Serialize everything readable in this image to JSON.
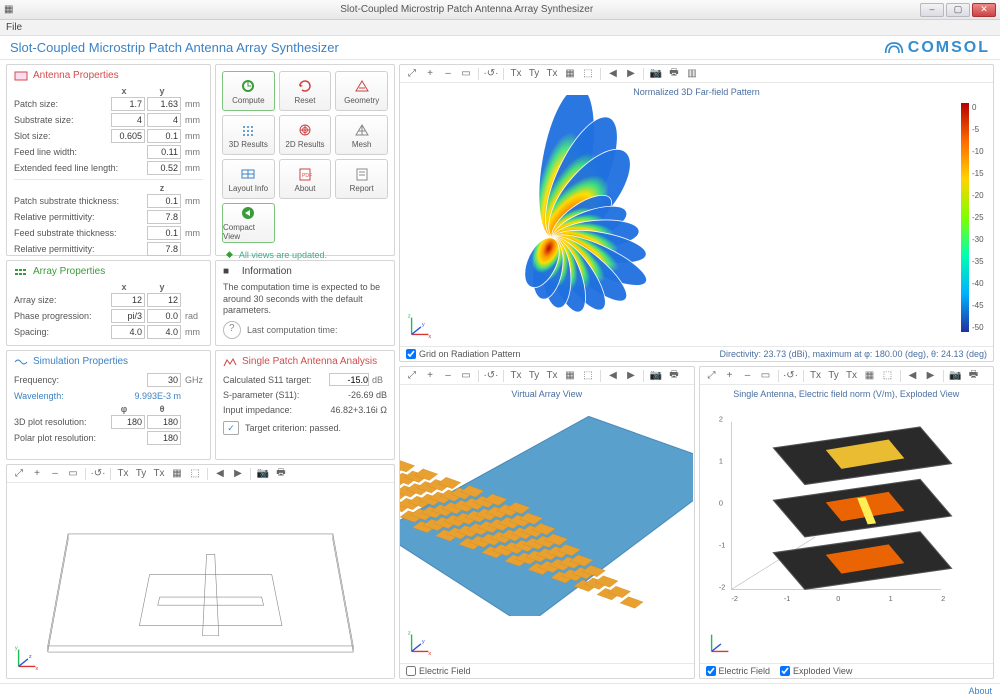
{
  "window": {
    "title": "Slot-Coupled Microstrip Patch Antenna Array Synthesizer",
    "min_icon": "–",
    "max_icon": "▢",
    "close_icon": "✕"
  },
  "menubar": {
    "file": "File"
  },
  "header": {
    "title": "Slot-Coupled Microstrip Patch Antenna Array Synthesizer",
    "brand": "COMSOL"
  },
  "antenna": {
    "title": "Antenna Properties",
    "col_x": "x",
    "col_y": "y",
    "rows_xy": [
      {
        "label": "Patch size:",
        "x": "1.7",
        "y": "1.63",
        "unit": "mm"
      },
      {
        "label": "Substrate size:",
        "x": "4",
        "y": "4",
        "unit": "mm"
      },
      {
        "label": "Slot size:",
        "x": "0.605",
        "y": "0.1",
        "unit": "mm"
      }
    ],
    "rows_single": [
      {
        "label": "Feed line width:",
        "v": "0.11",
        "unit": "mm"
      },
      {
        "label": "Extended feed line length:",
        "v": "0.52",
        "unit": "mm"
      }
    ],
    "col_z": "z",
    "rows_z": [
      {
        "label": "Patch substrate thickness:",
        "v": "0.1",
        "unit": "mm"
      },
      {
        "label": "Relative permittivity:",
        "v": "7.8",
        "unit": ""
      },
      {
        "label": "Feed substrate thickness:",
        "v": "0.1",
        "unit": "mm"
      },
      {
        "label": "Relative permittivity:",
        "v": "7.8",
        "unit": ""
      }
    ]
  },
  "array": {
    "title": "Array Properties",
    "col_x": "x",
    "col_y": "y",
    "rows": [
      {
        "label": "Array size:",
        "x": "12",
        "y": "12",
        "unit": ""
      },
      {
        "label": "Phase progression:",
        "x": "pi/3",
        "y": "0.0",
        "unit": "rad"
      },
      {
        "label": "Spacing:",
        "x": "4.0",
        "y": "4.0",
        "unit": "mm"
      }
    ]
  },
  "sim": {
    "title": "Simulation Properties",
    "freq_label": "Frequency:",
    "freq_v": "30",
    "freq_unit": "GHz",
    "wl_label": "Wavelength:",
    "wl_v": "9.993E-3 m",
    "col_phi": "φ",
    "col_theta": "θ",
    "res3d_label": "3D plot resolution:",
    "res3d_phi": "180",
    "res3d_theta": "180",
    "polar_label": "Polar plot resolution:",
    "polar_v": "180"
  },
  "buttons": {
    "labels": [
      "Compute",
      "Reset",
      "Geometry",
      "3D Results",
      "2D Results",
      "Mesh",
      "Layout Info",
      "About",
      "Report",
      "Compact View"
    ],
    "status_icon": "◆",
    "status": "All views are updated."
  },
  "info": {
    "title": "Information",
    "text": "The computation time is expected to be around 30 seconds with the default parameters.",
    "last_label": "Last computation time:"
  },
  "single": {
    "title": "Single Patch Antenna Analysis",
    "rows": [
      {
        "label": "Calculated S11 target:",
        "val": "-15.0",
        "unit": "dB",
        "input": true
      },
      {
        "label": "S-parameter (S11):",
        "val": "-26.69 dB"
      },
      {
        "label": "Input impedance:",
        "val": "46.82+3.16i Ω"
      }
    ],
    "pass": "Target criterion: passed."
  },
  "view_far": {
    "title": "Normalized 3D Far-field Pattern",
    "grid_label": "Grid on Radiation Pattern",
    "directivity": "Directivity: 23.73 (dBi), maximum at φ: 180.00 (deg), θ: 24.13 (deg)",
    "colorbar": [
      "0",
      "-5",
      "-10",
      "-15",
      "-20",
      "-25",
      "-30",
      "-35",
      "-40",
      "-45",
      "-50"
    ]
  },
  "view_array": {
    "title": "Virtual Array View",
    "ef_label": "Electric Field"
  },
  "view_single": {
    "title": "Single Antenna, Electric field norm (V/m), Exploded View",
    "ef_label": "Electric Field",
    "exp_label": "Exploded View",
    "axis_ticks": [
      "-2",
      "-1",
      "0",
      "1",
      "2"
    ]
  },
  "toolbar": {
    "zoom_fit": "⤢",
    "zoom_in": "+",
    "zoom_out": "–",
    "zoom_box": "▭",
    "rotate": "·↺·",
    "xy": "⌗",
    "tx": "Tx",
    "ty": "Ty",
    "grid": "▦",
    "sel": "⬚",
    "left": "◀",
    "right": "▶",
    "cam": "📷",
    "print": "🖶",
    "page": "▥"
  },
  "footer": {
    "about": "About"
  }
}
